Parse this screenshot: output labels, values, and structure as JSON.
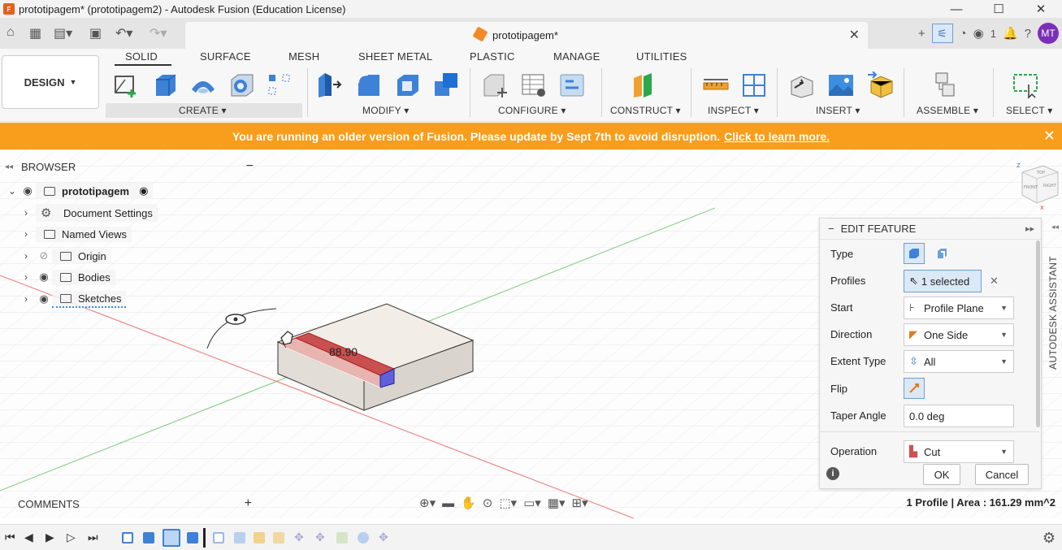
{
  "window": {
    "title": "prototipagem* (prototipagem2) - Autodesk Fusion (Education License)",
    "app_icon": "F",
    "minimize": "—",
    "maximize": "☐",
    "close": "✕"
  },
  "doc_tab": {
    "name": "prototipagem*",
    "close": "✕"
  },
  "quick_access": {
    "job_count": "1",
    "avatar_initials": "MT"
  },
  "ribbon": {
    "workspace": "DESIGN",
    "tabs": [
      "SOLID",
      "SURFACE",
      "MESH",
      "SHEET METAL",
      "PLASTIC",
      "MANAGE",
      "UTILITIES"
    ],
    "groups": [
      "CREATE",
      "MODIFY",
      "CONFIGURE",
      "CONSTRUCT",
      "INSPECT",
      "INSERT",
      "ASSEMBLE",
      "SELECT"
    ]
  },
  "banner": {
    "message": "You are running an older version of Fusion. Please update by Sept 7th to avoid disruption.",
    "link": "Click to learn more.",
    "close": "✕"
  },
  "browser": {
    "title": "BROWSER",
    "root": "prototipagem",
    "items": [
      "Document Settings",
      "Named Views",
      "Origin",
      "Bodies",
      "Sketches"
    ]
  },
  "viewport": {
    "dimension": "88.90",
    "viewcube_top": "TOP",
    "viewcube_front": "FRONT",
    "viewcube_right": "RIGHT",
    "axis_z": "Z",
    "axis_x": "X"
  },
  "edit_feature": {
    "title": "EDIT FEATURE",
    "rows": {
      "type": {
        "label": "Type"
      },
      "profiles": {
        "label": "Profiles",
        "value": "1 selected"
      },
      "start": {
        "label": "Start",
        "value": "Profile Plane"
      },
      "direction": {
        "label": "Direction",
        "value": "One Side"
      },
      "extent": {
        "label": "Extent Type",
        "value": "All"
      },
      "flip": {
        "label": "Flip"
      },
      "taper": {
        "label": "Taper Angle",
        "value": "0.0 deg"
      },
      "operation": {
        "label": "Operation",
        "value": "Cut"
      }
    },
    "ok": "OK",
    "cancel": "Cancel"
  },
  "assistant": {
    "label": "AUTODESK ASSISTANT"
  },
  "comments": {
    "label": "COMMENTS"
  },
  "status": {
    "text": "1 Profile | Area : 161.29 mm^2"
  },
  "colors": {
    "banner": "#f99d1c",
    "accent": "#3a75c4",
    "avatar": "#7b2fb8"
  }
}
